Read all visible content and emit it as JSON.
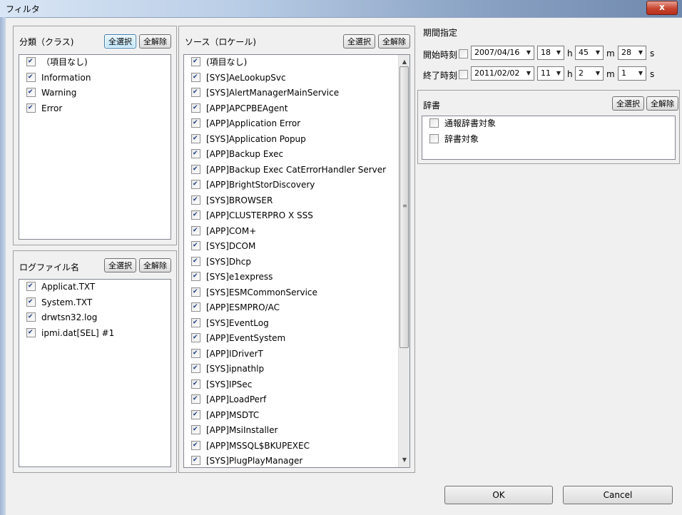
{
  "window": {
    "title": "フィルタ",
    "close_label": "x"
  },
  "classification": {
    "header": "分類（クラス)",
    "select_all": "全選択",
    "clear_all": "全解除",
    "items": [
      {
        "label": "（項目なし)",
        "checked": true
      },
      {
        "label": "Information",
        "checked": true
      },
      {
        "label": "Warning",
        "checked": true
      },
      {
        "label": "Error",
        "checked": true
      }
    ]
  },
  "logfile": {
    "header": "ログファイル名",
    "select_all": "全選択",
    "clear_all": "全解除",
    "items": [
      {
        "label": "Applicat.TXT",
        "checked": true
      },
      {
        "label": "System.TXT",
        "checked": true
      },
      {
        "label": "drwtsn32.log",
        "checked": true
      },
      {
        "label": "ipmi.dat[SEL] #1",
        "checked": true
      }
    ]
  },
  "source": {
    "header": "ソース（ロケール)",
    "select_all": "全選択",
    "clear_all": "全解除",
    "items": [
      {
        "label": "(項目なし)",
        "checked": true
      },
      {
        "label": "[SYS]AeLookupSvc",
        "checked": true
      },
      {
        "label": "[SYS]AlertManagerMainService",
        "checked": true
      },
      {
        "label": "[APP]APCPBEAgent",
        "checked": true
      },
      {
        "label": "[APP]Application Error",
        "checked": true
      },
      {
        "label": "[SYS]Application Popup",
        "checked": true
      },
      {
        "label": "[APP]Backup Exec",
        "checked": true
      },
      {
        "label": "[APP]Backup Exec CatErrorHandler Server",
        "checked": true
      },
      {
        "label": "[APP]BrightStorDiscovery",
        "checked": true
      },
      {
        "label": "[SYS]BROWSER",
        "checked": true
      },
      {
        "label": "[APP]CLUSTERPRO X SSS",
        "checked": true
      },
      {
        "label": "[APP]COM+",
        "checked": true
      },
      {
        "label": "[SYS]DCOM",
        "checked": true
      },
      {
        "label": "[SYS]Dhcp",
        "checked": true
      },
      {
        "label": "[SYS]e1express",
        "checked": true
      },
      {
        "label": "[SYS]ESMCommonService",
        "checked": true
      },
      {
        "label": "[APP]ESMPRO/AC",
        "checked": true
      },
      {
        "label": "[SYS]EventLog",
        "checked": true
      },
      {
        "label": "[APP]EventSystem",
        "checked": true
      },
      {
        "label": "[APP]IDriverT",
        "checked": true
      },
      {
        "label": "[SYS]ipnathlp",
        "checked": true
      },
      {
        "label": "[SYS]IPSec",
        "checked": true
      },
      {
        "label": "[APP]LoadPerf",
        "checked": true
      },
      {
        "label": "[APP]MSDTC",
        "checked": true
      },
      {
        "label": "[APP]MsiInstaller",
        "checked": true
      },
      {
        "label": "[APP]MSSQL$BKUPEXEC",
        "checked": true
      },
      {
        "label": "[SYS]PlugPlayManager",
        "checked": true
      }
    ]
  },
  "period": {
    "header": "期間指定",
    "start": {
      "label": "開始時刻",
      "date": "2007/04/16",
      "hour": "18",
      "minute": "45",
      "second": "28"
    },
    "end": {
      "label": "終了時刻",
      "date": "2011/02/02",
      "hour": "11",
      "minute": "2",
      "second": "1"
    },
    "units": {
      "h": "h",
      "m": "m",
      "s": "s"
    }
  },
  "dictionary": {
    "header": "辞書",
    "select_all": "全選択",
    "clear_all": "全解除",
    "items": [
      {
        "label": "通報辞書対象",
        "checked": false
      },
      {
        "label": "辞書対象",
        "checked": false
      }
    ]
  },
  "buttons": {
    "ok": "OK",
    "cancel": "Cancel"
  }
}
